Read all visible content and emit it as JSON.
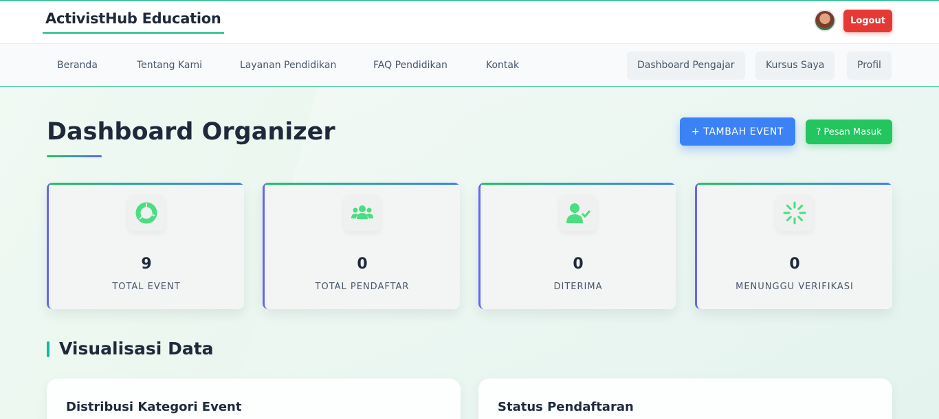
{
  "brand": "ActivistHub Education",
  "header": {
    "logout_label": "Logout"
  },
  "nav": {
    "links": [
      "Beranda",
      "Tentang Kami",
      "Layanan Pendidikan",
      "FAQ Pendidikan",
      "Kontak"
    ],
    "pills": [
      "Dashboard Pengajar",
      "Kursus Saya",
      "Profil"
    ]
  },
  "page": {
    "title": "Dashboard Organizer",
    "add_event_label": "+ TAMBAH EVENT",
    "messages_label": "? Pesan Masuk"
  },
  "stats": [
    {
      "value": "9",
      "label": "TOTAL EVENT",
      "icon": "chart-pie-icon"
    },
    {
      "value": "0",
      "label": "TOTAL PENDAFTAR",
      "icon": "users-icon"
    },
    {
      "value": "0",
      "label": "DITERIMA",
      "icon": "user-check-icon"
    },
    {
      "value": "0",
      "label": "MENUNGGU VERIFIKASI",
      "icon": "spinner-icon"
    }
  ],
  "section": {
    "title": "Visualisasi Data"
  },
  "panels": [
    {
      "title": "Distribusi Kategori Event"
    },
    {
      "title": "Status Pendaftaran"
    }
  ],
  "colors": {
    "accent_green": "#22c55e",
    "accent_blue": "#3b82f6",
    "logout_red": "#e53935",
    "brand_line": "#10b981"
  }
}
